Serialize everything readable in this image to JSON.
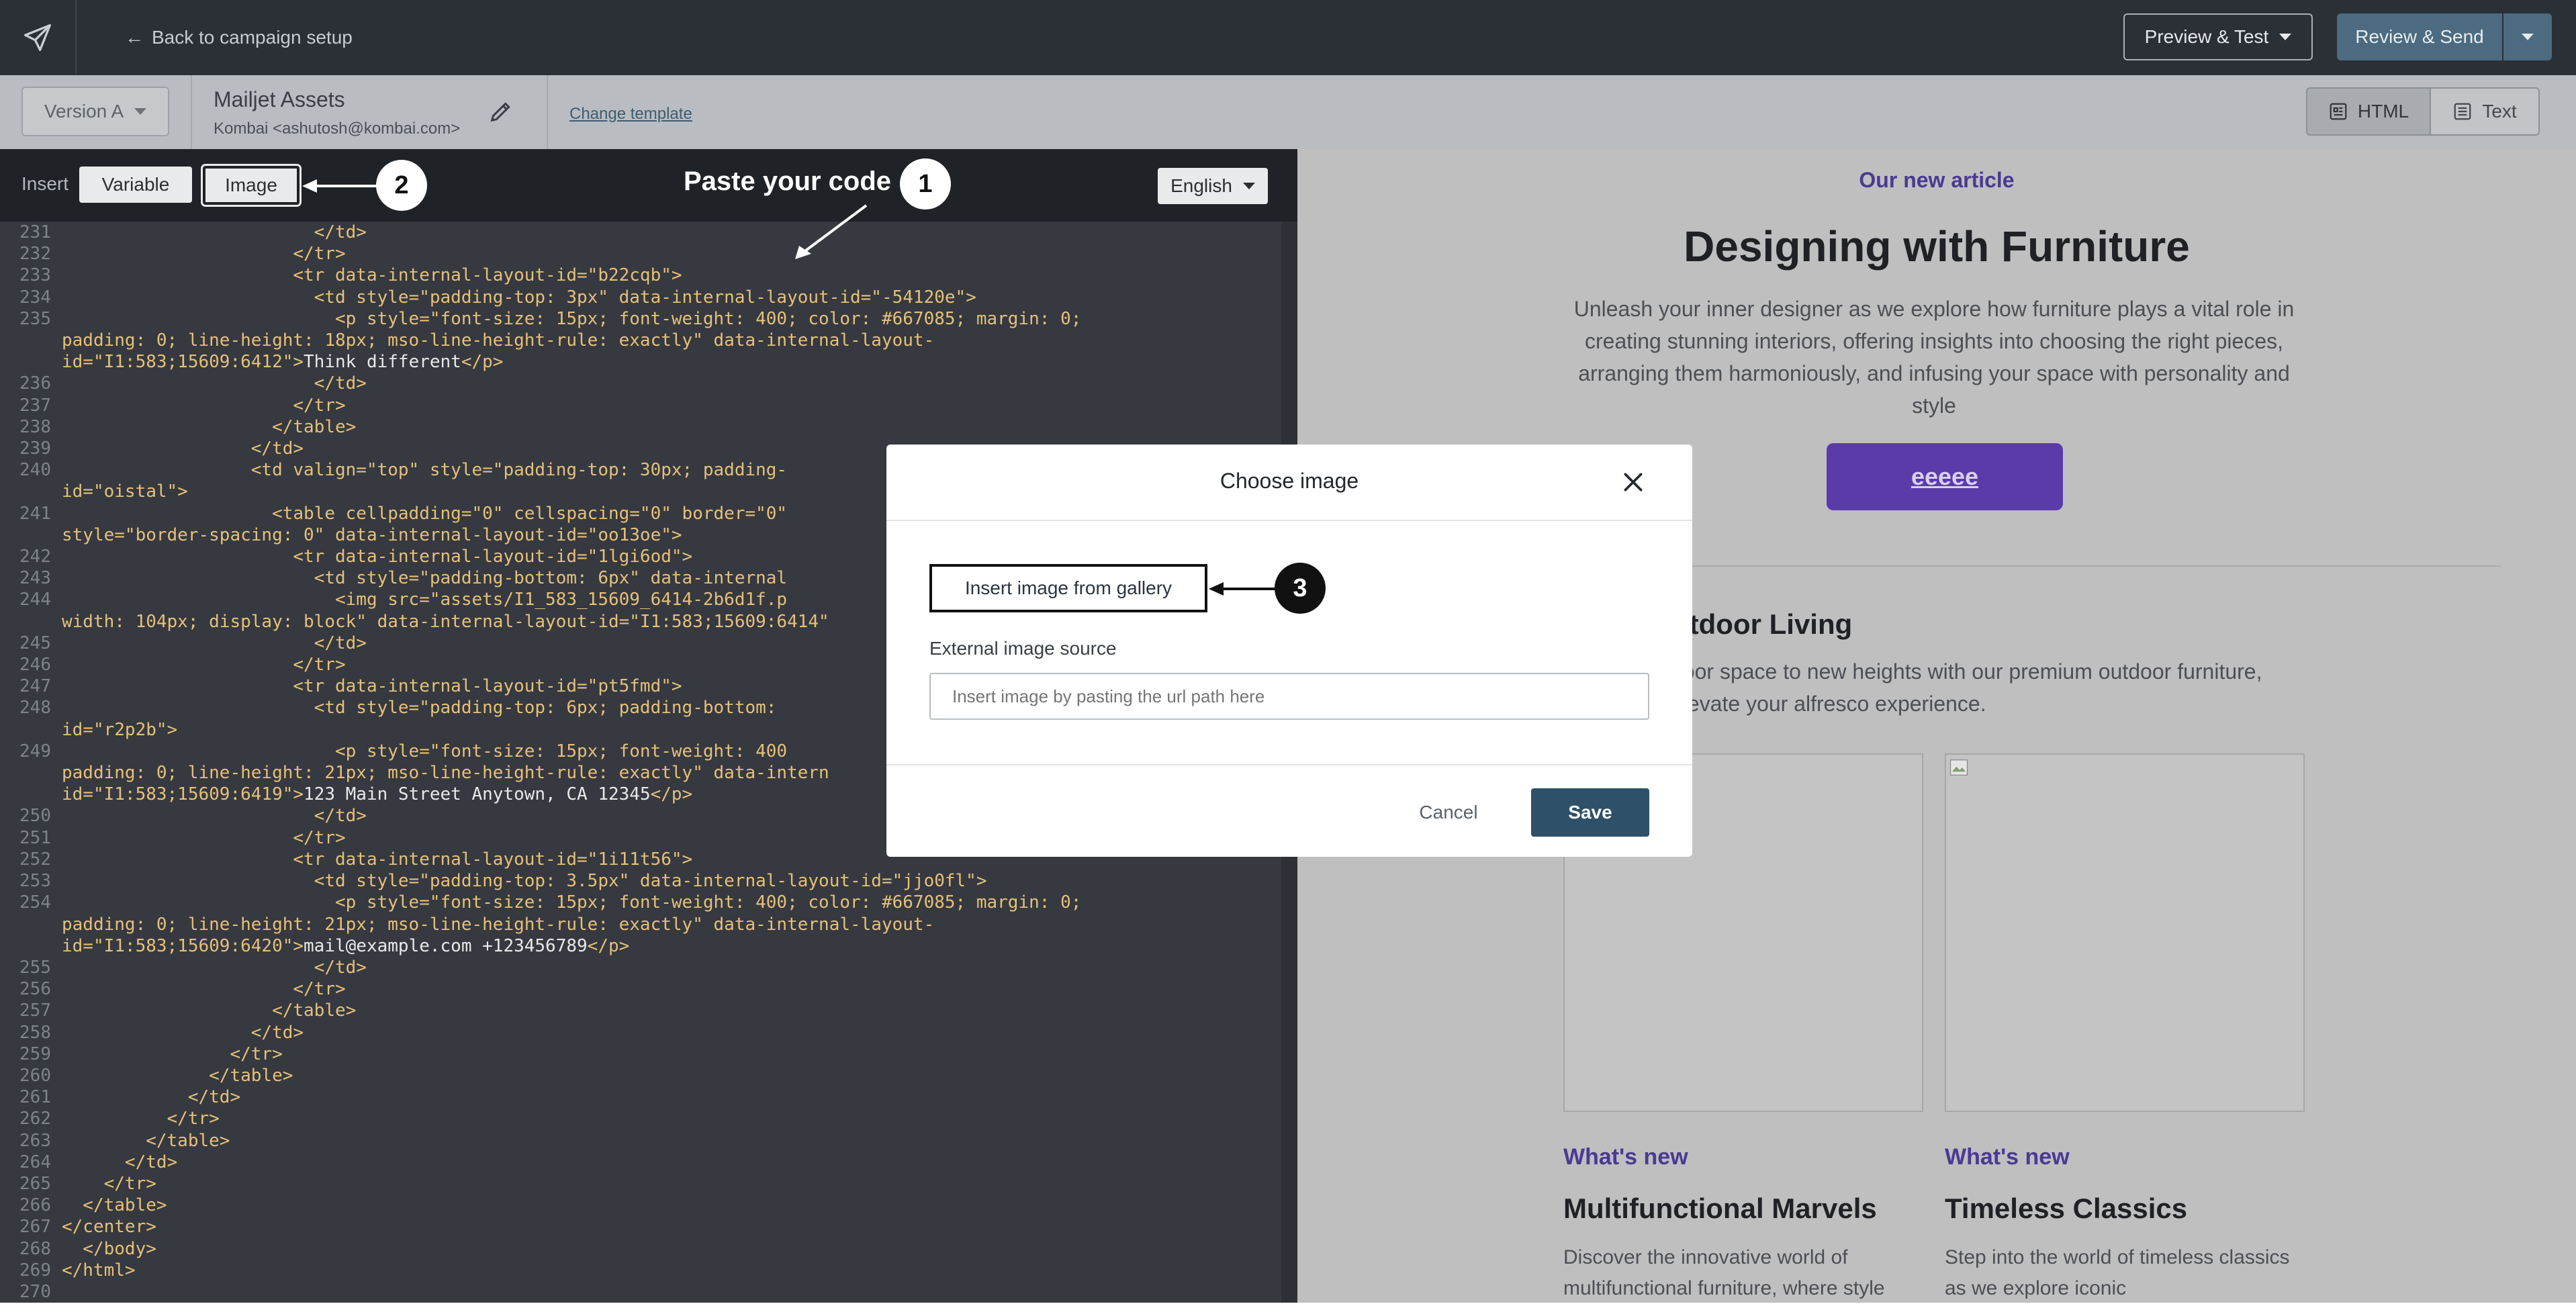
{
  "topbar": {
    "back_label": "Back to campaign setup",
    "preview_label": "Preview & Test",
    "review_label": "Review & Send"
  },
  "subbar": {
    "version_label": "Version A",
    "asset_name": "Mailjet Assets",
    "asset_from": "Kombai <ashutosh@kombai.com>",
    "change_template": "Change template",
    "html_tab": "HTML",
    "text_tab": "Text"
  },
  "editor": {
    "insert_label": "Insert",
    "variable_btn": "Variable",
    "image_btn": "Image",
    "language": "English",
    "annotation_paste": "Paste your code",
    "badges": [
      "1",
      "2",
      "3"
    ],
    "lines": [
      {
        "n": "231",
        "parts": [
          [
            "t",
            "                        </td>"
          ]
        ]
      },
      {
        "n": "232",
        "parts": [
          [
            "t",
            "                      </tr>"
          ]
        ]
      },
      {
        "n": "233",
        "parts": [
          [
            "t",
            "                      <tr data-internal-layout-id=\"b22cqb\">"
          ]
        ]
      },
      {
        "n": "234",
        "parts": [
          [
            "t",
            "                        <td style=\"padding-top: 3px\" data-internal-layout-id=\"-54120e\">"
          ]
        ]
      },
      {
        "n": "235",
        "parts": [
          [
            "t",
            "                          <p style=\"font-size: 15px; font-weight: 400; color: #667085; margin: 0;"
          ]
        ]
      },
      {
        "n": "",
        "parts": [
          [
            "t",
            "padding: 0; line-height: 18px; mso-line-height-rule: exactly\" data-internal-layout-"
          ]
        ]
      },
      {
        "n": "",
        "parts": [
          [
            "t",
            "id=\"I1:583;15609:6412\">"
          ],
          [
            "x",
            "Think different"
          ],
          [
            "t",
            "</p>"
          ]
        ]
      },
      {
        "n": "236",
        "parts": [
          [
            "t",
            "                        </td>"
          ]
        ]
      },
      {
        "n": "237",
        "parts": [
          [
            "t",
            "                      </tr>"
          ]
        ]
      },
      {
        "n": "238",
        "parts": [
          [
            "t",
            "                    </table>"
          ]
        ]
      },
      {
        "n": "239",
        "parts": [
          [
            "t",
            "                  </td>"
          ]
        ]
      },
      {
        "n": "240",
        "parts": [
          [
            "t",
            "                  <td valign=\"top\" style=\"padding-top: 30px; padding-"
          ]
        ]
      },
      {
        "n": "",
        "parts": [
          [
            "t",
            "id=\"oistal\">"
          ]
        ]
      },
      {
        "n": "241",
        "parts": [
          [
            "t",
            "                    <table cellpadding=\"0\" cellspacing=\"0\" border=\"0\""
          ]
        ]
      },
      {
        "n": "",
        "parts": [
          [
            "t",
            "style=\"border-spacing: 0\" data-internal-layout-id=\"oo13oe\">"
          ]
        ]
      },
      {
        "n": "242",
        "parts": [
          [
            "t",
            "                      <tr data-internal-layout-id=\"1lgi6od\">"
          ]
        ]
      },
      {
        "n": "243",
        "parts": [
          [
            "t",
            "                        <td style=\"padding-bottom: 6px\" data-internal"
          ]
        ]
      },
      {
        "n": "244",
        "parts": [
          [
            "t",
            "                          <img src=\"assets/I1_583_15609_6414-2b6d1f.p"
          ]
        ]
      },
      {
        "n": "",
        "parts": [
          [
            "t",
            "width: 104px; display: block\" data-internal-layout-id=\"I1:583;15609:6414\""
          ]
        ]
      },
      {
        "n": "245",
        "parts": [
          [
            "t",
            "                        </td>"
          ]
        ]
      },
      {
        "n": "246",
        "parts": [
          [
            "t",
            "                      </tr>"
          ]
        ]
      },
      {
        "n": "247",
        "parts": [
          [
            "t",
            "                      <tr data-internal-layout-id=\"pt5fmd\">"
          ]
        ]
      },
      {
        "n": "248",
        "parts": [
          [
            "t",
            "                        <td style=\"padding-top: 6px; padding-bottom:"
          ]
        ]
      },
      {
        "n": "",
        "parts": [
          [
            "t",
            "id=\"r2p2b\">"
          ]
        ]
      },
      {
        "n": "249",
        "parts": [
          [
            "t",
            "                          <p style=\"font-size: 15px; font-weight: 400"
          ]
        ]
      },
      {
        "n": "",
        "parts": [
          [
            "t",
            "padding: 0; line-height: 21px; mso-line-height-rule: exactly\" data-intern"
          ]
        ]
      },
      {
        "n": "",
        "parts": [
          [
            "t",
            "id=\"I1:583;15609:6419\">"
          ],
          [
            "x",
            "123 Main Street Anytown, CA 12345"
          ],
          [
            "t",
            "</p>"
          ]
        ]
      },
      {
        "n": "250",
        "parts": [
          [
            "t",
            "                        </td>"
          ]
        ]
      },
      {
        "n": "251",
        "parts": [
          [
            "t",
            "                      </tr>"
          ]
        ]
      },
      {
        "n": "252",
        "parts": [
          [
            "t",
            "                      <tr data-internal-layout-id=\"1i11t56\">"
          ]
        ]
      },
      {
        "n": "253",
        "parts": [
          [
            "t",
            "                        <td style=\"padding-top: 3.5px\" data-internal-layout-id=\"jjo0fl\">"
          ]
        ]
      },
      {
        "n": "254",
        "parts": [
          [
            "t",
            "                          <p style=\"font-size: 15px; font-weight: 400; color: #667085; margin: 0;"
          ]
        ]
      },
      {
        "n": "",
        "parts": [
          [
            "t",
            "padding: 0; line-height: 21px; mso-line-height-rule: exactly\" data-internal-layout-"
          ]
        ]
      },
      {
        "n": "",
        "parts": [
          [
            "t",
            "id=\"I1:583;15609:6420\">"
          ],
          [
            "x",
            "mail@example.com +123456789"
          ],
          [
            "t",
            "</p>"
          ]
        ]
      },
      {
        "n": "255",
        "parts": [
          [
            "t",
            "                        </td>"
          ]
        ]
      },
      {
        "n": "256",
        "parts": [
          [
            "t",
            "                      </tr>"
          ]
        ]
      },
      {
        "n": "257",
        "parts": [
          [
            "t",
            "                    </table>"
          ]
        ]
      },
      {
        "n": "258",
        "parts": [
          [
            "t",
            "                  </td>"
          ]
        ]
      },
      {
        "n": "259",
        "parts": [
          [
            "t",
            "                </tr>"
          ]
        ]
      },
      {
        "n": "260",
        "parts": [
          [
            "t",
            "              </table>"
          ]
        ]
      },
      {
        "n": "261",
        "parts": [
          [
            "t",
            "            </td>"
          ]
        ]
      },
      {
        "n": "262",
        "parts": [
          [
            "t",
            "          </tr>"
          ]
        ]
      },
      {
        "n": "263",
        "parts": [
          [
            "t",
            "        </table>"
          ]
        ]
      },
      {
        "n": "264",
        "parts": [
          [
            "t",
            "      </td>"
          ]
        ]
      },
      {
        "n": "265",
        "parts": [
          [
            "t",
            "    </tr>"
          ]
        ]
      },
      {
        "n": "266",
        "parts": [
          [
            "t",
            "  </table>"
          ]
        ]
      },
      {
        "n": "267",
        "parts": [
          [
            "t",
            "</center>"
          ]
        ]
      },
      {
        "n": "268",
        "parts": [
          [
            "t",
            "  </body>"
          ]
        ]
      },
      {
        "n": "269",
        "parts": [
          [
            "t",
            "</html>"
          ]
        ]
      },
      {
        "n": "270",
        "parts": []
      }
    ]
  },
  "preview": {
    "kicker": "Our new article",
    "title": "Designing with Furniture",
    "description": "Unleash your inner designer as we explore how furniture plays a vital role in creating stunning interiors, offering insights into choosing the right pieces, arranging them harmoniously, and infusing your space with personality and style",
    "button": "eeeee",
    "section_title": "utdoor Living",
    "section_desc": "door space to new heights with our premium outdoor furniture, elevate your alfresco experience.",
    "cards": [
      {
        "kicker": "What's new",
        "title": "Multifunctional Marvels",
        "desc": "Discover the innovative world of multifunctional furniture, where style"
      },
      {
        "kicker": "What's new",
        "title": "Timeless Classics",
        "desc": "Step into the world of timeless classics as we explore iconic"
      }
    ]
  },
  "modal": {
    "title": "Choose image",
    "gallery_btn": "Insert image from gallery",
    "ext_label": "External image source",
    "ext_placeholder": "Insert image by pasting the url path here",
    "cancel": "Cancel",
    "save": "Save"
  },
  "colors": {
    "accent_purple": "#5a3ba8",
    "save_blue": "#2e5068",
    "topbar": "#2b2f36"
  }
}
